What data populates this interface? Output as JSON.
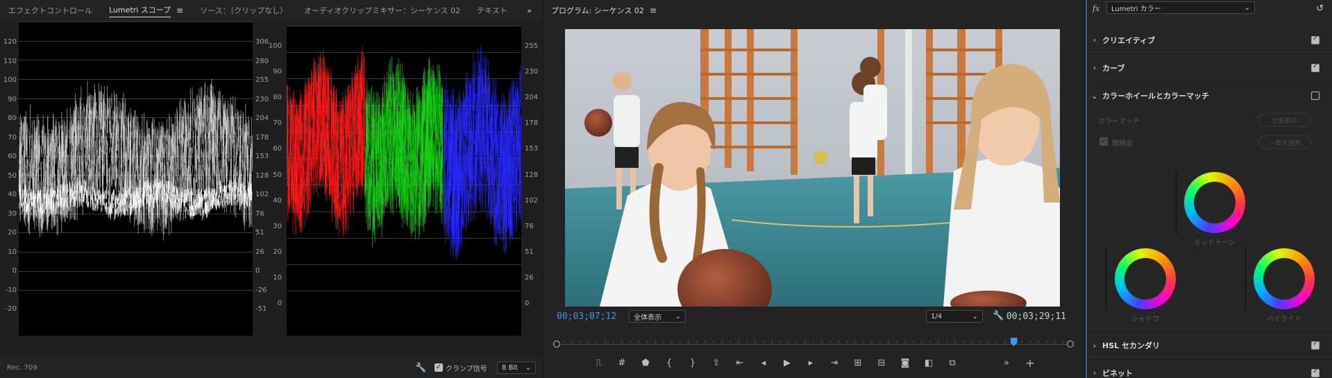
{
  "scopes_panel": {
    "tabs": [
      "エフェクトコントロール",
      "Lumetri スコープ",
      "ソース：（クリップなし）",
      "オーディオクリップミキサー：シーケンス 02",
      "テキスト"
    ],
    "active_tab": "Lumetri スコープ",
    "waveform": {
      "left_axis": [
        "120",
        "110",
        "100",
        "90",
        "80",
        "70",
        "60",
        "50",
        "40",
        "30",
        "20",
        "10",
        "0",
        "-10",
        "-20"
      ],
      "right_axis": [
        "306",
        "280",
        "255",
        "230",
        "204",
        "178",
        "153",
        "128",
        "102",
        "76",
        "51",
        "26",
        "0",
        "-26",
        "-51"
      ]
    },
    "parade": {
      "left_axis": [
        "100",
        "90",
        "80",
        "70",
        "60",
        "50",
        "40",
        "30",
        "20",
        "10",
        "0"
      ],
      "right_axis": [
        "255",
        "230",
        "204",
        "178",
        "153",
        "128",
        "102",
        "76",
        "51",
        "26",
        "0"
      ]
    },
    "footer": {
      "colorspace": "Rec. 709",
      "clamp_label": "クランプ信号",
      "bit_depth": "8 Bit"
    }
  },
  "program_monitor": {
    "title": "プログラム: シーケンス 02",
    "current_timecode": "00;03;07;12",
    "duration_timecode": "00;03;29;11",
    "zoom": "全体表示",
    "resolution": "1/4",
    "playhead_fraction": 0.89
  },
  "lumetri": {
    "fx_label": "fx",
    "preset": "Lumetri カラー",
    "sections": [
      {
        "label": "クリエイティブ",
        "checked": true
      },
      {
        "label": "カーブ",
        "checked": true
      },
      {
        "label": "カラーホイールとカラーマッチ",
        "checked": false
      }
    ],
    "color_match": {
      "label": "カラーマッチ",
      "compare_button": "比較表示",
      "face_detect": "顔検出",
      "apply_button": "一致を適用"
    },
    "wheels": {
      "midtone": "ミッドトーン",
      "shadow": "シャドウ",
      "highlight": "ハイライト"
    },
    "bottom_sections": [
      {
        "label": "HSL セカンダリ",
        "checked": true
      },
      {
        "label": "ビネット",
        "checked": true
      }
    ]
  }
}
